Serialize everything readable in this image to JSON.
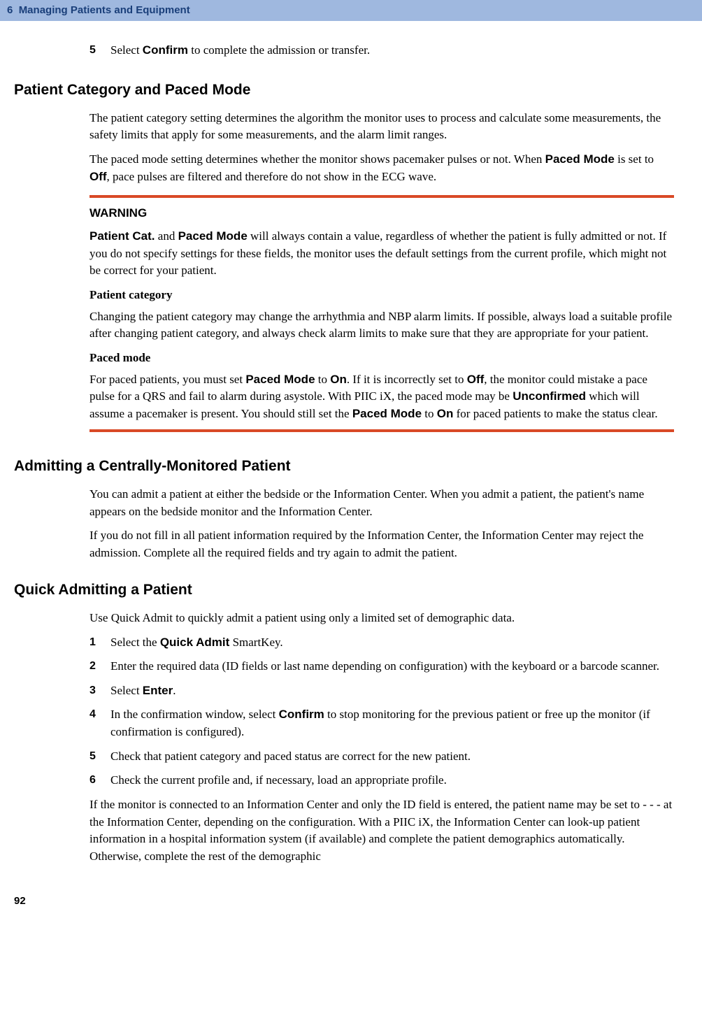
{
  "header": {
    "chapter_num": "6",
    "chapter_title": "Managing Patients and Equipment"
  },
  "step5": {
    "num": "5",
    "text_pre": "Select ",
    "text_bold": "Confirm",
    "text_post": " to complete the admission or transfer."
  },
  "section1": {
    "heading": "Patient Category and Paced Mode",
    "p1": "The patient category setting determines the algorithm the monitor uses to process and calculate some measurements, the safety limits that apply for some measurements, and the alarm limit ranges.",
    "p2_pre": "The paced mode setting determines whether the monitor shows pacemaker pulses or not. When ",
    "p2_b1": "Paced Mode",
    "p2_mid": " is set to ",
    "p2_b2": "Off",
    "p2_post": ", pace pulses are filtered and therefore do not show in the ECG wave."
  },
  "warning": {
    "title": "WARNING",
    "p1_b1": "Patient Cat.",
    "p1_mid": " and ",
    "p1_b2": "Paced Mode",
    "p1_post": " will always contain a value, regardless of whether the patient is fully admitted or not. If you do not specify settings for these fields, the monitor uses the default settings from the current profile, which might not be correct for your patient.",
    "sub1_head": "Patient category",
    "sub1_text": "Changing the patient category may change the arrhythmia and NBP alarm limits. If possible, always load a suitable profile after changing patient category, and always check alarm limits to make sure that they are appropriate for your patient.",
    "sub2_head": "Paced mode",
    "sub2_p1": "For paced patients, you must set ",
    "sub2_b1": "Paced Mode",
    "sub2_p2": " to ",
    "sub2_b2": "On",
    "sub2_p3": ". If it is incorrectly set to ",
    "sub2_b3": "Off",
    "sub2_p4": ", the monitor could mistake a pace pulse for a QRS and fail to alarm during asystole. With PIIC iX, the paced mode may be ",
    "sub2_b4": "Unconfirmed",
    "sub2_p5": " which will assume a pacemaker is present. You should still set the ",
    "sub2_b5": "Paced Mode",
    "sub2_p6": " to ",
    "sub2_b6": "On",
    "sub2_p7": " for paced patients to make the status clear."
  },
  "section2": {
    "heading": "Admitting a Centrally-Monitored Patient",
    "p1": "You can admit a patient at either the bedside or the Information Center. When you admit a patient, the patient's name appears on the bedside monitor and the Information Center.",
    "p2": "If you do not fill in all patient information required by the Information Center, the Information Center may reject the admission. Complete all the required fields and try again to admit the patient."
  },
  "section3": {
    "heading": "Quick Admitting a Patient",
    "intro": "Use Quick Admit to quickly admit a patient using only a limited set of demographic data.",
    "steps": [
      {
        "num": "1",
        "pre": "Select the ",
        "bold": "Quick Admit",
        "post": " SmartKey."
      },
      {
        "num": "2",
        "pre": "Enter the required data (ID fields or last name depending on configuration) with the keyboard or a barcode scanner.",
        "bold": "",
        "post": ""
      },
      {
        "num": "3",
        "pre": "Select ",
        "bold": "Enter",
        "post": "."
      },
      {
        "num": "4",
        "pre": "In the confirmation window, select ",
        "bold": "Confirm",
        "post": " to stop monitoring for the previous patient or free up the monitor (if confirmation is configured)."
      },
      {
        "num": "5",
        "pre": "Check that patient category and paced status are correct for the new patient.",
        "bold": "",
        "post": ""
      },
      {
        "num": "6",
        "pre": "Check the current profile and, if necessary, load an appropriate profile.",
        "bold": "",
        "post": ""
      }
    ],
    "outro": "If the monitor is connected to an Information Center and only the ID field is entered, the patient name may be set to - - - at the Information Center, depending on the configuration. With a PIIC iX, the Information Center can look-up patient information in a hospital information system (if available) and complete the patient demographics automatically. Otherwise, complete the rest of the demographic"
  },
  "page_number": "92"
}
